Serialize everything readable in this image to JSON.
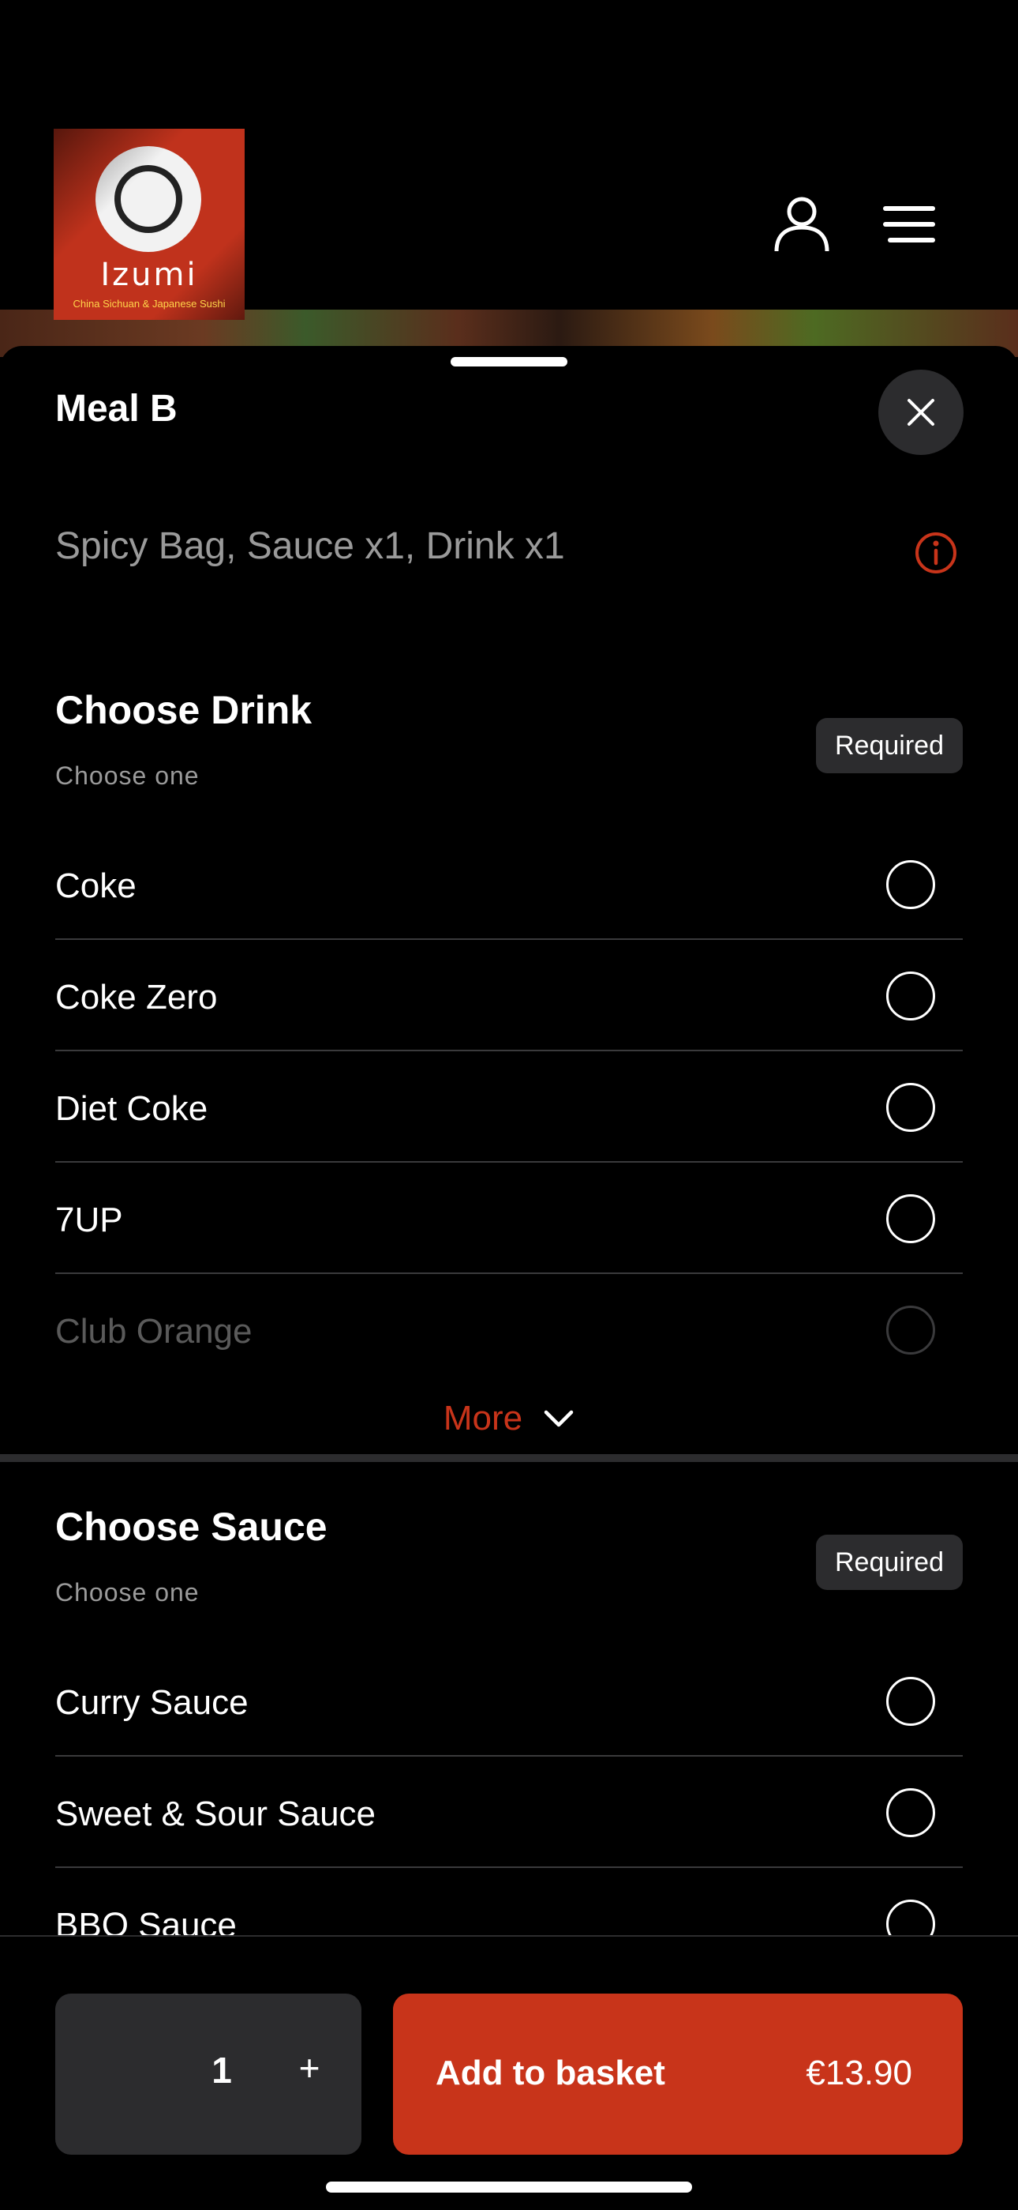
{
  "header": {
    "logo": {
      "brand": "Izumi",
      "subtitle": "China Sichuan & Japanese Sushi"
    },
    "icons": {
      "account": "user-icon",
      "menu": "hamburger-menu-icon"
    }
  },
  "sheet": {
    "title": "Meal B",
    "description": "Spicy Bag, Sauce x1, Drink x1",
    "icons": {
      "close": "close-icon",
      "info": "info-icon"
    },
    "sections": [
      {
        "title": "Choose Drink",
        "subtitle": "Choose one",
        "badge": "Required",
        "options": [
          "Coke",
          "Coke Zero",
          "Diet Coke",
          "7UP",
          "Club Orange"
        ],
        "more_label": "More"
      },
      {
        "title": "Choose Sauce",
        "subtitle": "Choose one",
        "badge": "Required",
        "options": [
          "Curry Sauce",
          "Sweet & Sour Sauce",
          "BBQ Sauce"
        ]
      }
    ]
  },
  "footer": {
    "quantity": "1",
    "plus": "+",
    "add_label": "Add to basket",
    "price": "€13.90"
  },
  "colors": {
    "accent": "#c8341a",
    "surface": "#2c2c2e",
    "background": "#000000",
    "muted_text": "#9a9a9a"
  }
}
